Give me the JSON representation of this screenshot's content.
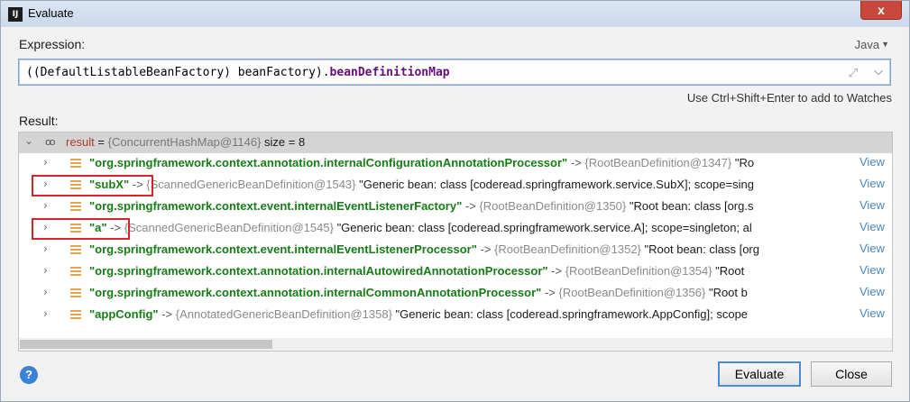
{
  "window": {
    "title": "Evaluate",
    "app_icon": "IJ",
    "close_glyph": "x"
  },
  "expression": {
    "label": "Expression:",
    "language": "Java",
    "code_prefix": "((DefaultListableBeanFactory) beanFactory).",
    "code_field": "beanDefinitionMap"
  },
  "hint": "Use Ctrl+Shift+Enter to add to Watches",
  "result": {
    "label": "Result:",
    "root": {
      "name": "result",
      "eq": " = ",
      "value": "{ConcurrentHashMap@1146}",
      "size": "size = 8"
    },
    "view_label": "View",
    "entries": [
      {
        "key": "\"org.springframework.context.annotation.internalConfigurationAnnotationProcessor\"",
        "ref": "{RootBeanDefinition@1347}",
        "desc": "\"Ro"
      },
      {
        "key": "\"subX\"",
        "ref": "{ScannedGenericBeanDefinition@1543}",
        "desc": "\"Generic bean: class [coderead.springframework.service.SubX]; scope=sing"
      },
      {
        "key": "\"org.springframework.context.event.internalEventListenerFactory\"",
        "ref": "{RootBeanDefinition@1350}",
        "desc": "\"Root bean: class [org.s"
      },
      {
        "key": "\"a\"",
        "ref": "{ScannedGenericBeanDefinition@1545}",
        "desc": "\"Generic bean: class [coderead.springframework.service.A]; scope=singleton; al"
      },
      {
        "key": "\"org.springframework.context.event.internalEventListenerProcessor\"",
        "ref": "{RootBeanDefinition@1352}",
        "desc": "\"Root bean: class [org"
      },
      {
        "key": "\"org.springframework.context.annotation.internalAutowiredAnnotationProcessor\"",
        "ref": "{RootBeanDefinition@1354}",
        "desc": "\"Root"
      },
      {
        "key": "\"org.springframework.context.annotation.internalCommonAnnotationProcessor\"",
        "ref": "{RootBeanDefinition@1356}",
        "desc": "\"Root b"
      },
      {
        "key": "\"appConfig\"",
        "ref": "{AnnotatedGenericBeanDefinition@1358}",
        "desc": "\"Generic bean: class [coderead.springframework.AppConfig]; scope"
      }
    ]
  },
  "buttons": {
    "help": "?",
    "evaluate": "Evaluate",
    "close": "Close"
  },
  "icons": {
    "expand": "expand-icon",
    "glasses": "watch-glasses-icon",
    "entry": "map-entry-icon"
  },
  "colors": {
    "highlight_box": "#d8232a",
    "key_green": "#167c16",
    "link_blue": "#4a84c9",
    "accent": "#4a8ad8"
  }
}
